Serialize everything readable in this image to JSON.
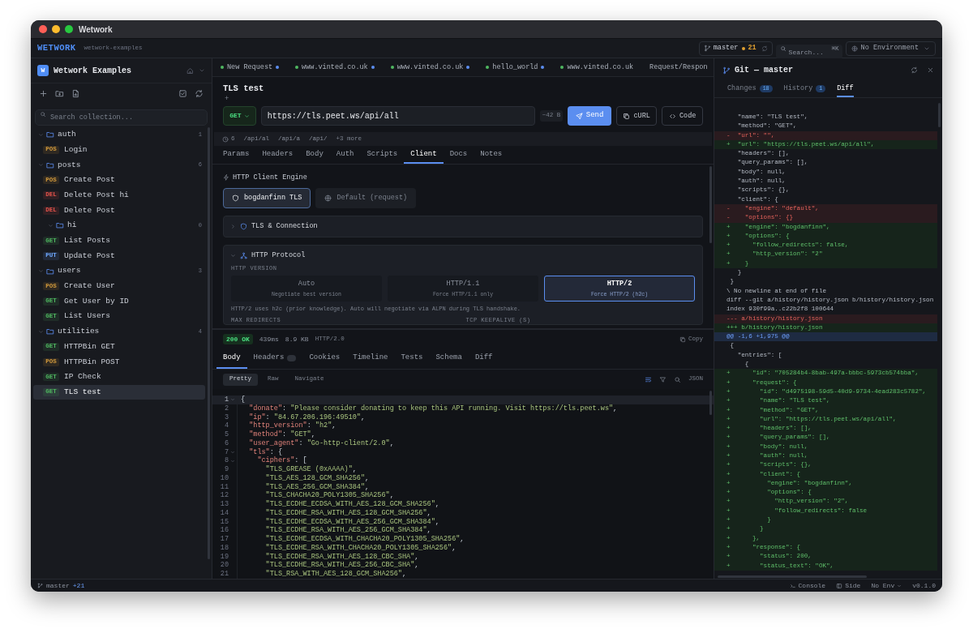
{
  "window": {
    "title": "Wetwork"
  },
  "header": {
    "logo": "WETWORK",
    "workspace": "wetwork-examples",
    "branch": "master",
    "changes": "21",
    "search_placeholder": "Search...",
    "search_shortcut": "⌘K",
    "environment": "No Environment"
  },
  "sidebar": {
    "logo_letter": "W",
    "collection": "Wetwork Examples",
    "search_placeholder": "Search collection...",
    "tree": [
      {
        "kind": "folder",
        "name": "auth",
        "count": "1",
        "expanded": true,
        "children": [
          {
            "kind": "request",
            "method": "POS",
            "color": "#d29a3c",
            "name": "Login",
            "selected": false
          }
        ]
      },
      {
        "kind": "folder",
        "name": "posts",
        "count": "6",
        "expanded": true,
        "children": [
          {
            "kind": "request",
            "method": "POS",
            "color": "#d29a3c",
            "name": "Create Post",
            "selected": false
          },
          {
            "kind": "request",
            "method": "DEL",
            "color": "#e5534b",
            "name": "Delete Post hi",
            "selected": false
          },
          {
            "kind": "request",
            "method": "DEL",
            "color": "#e5534b",
            "name": "Delete Post",
            "selected": false
          },
          {
            "kind": "folder",
            "name": "hi",
            "count": "0",
            "expanded": true
          },
          {
            "kind": "request",
            "method": "GET",
            "color": "#4fb860",
            "name": "List Posts",
            "selected": false
          },
          {
            "kind": "request",
            "method": "PUT",
            "color": "#6ea8ff",
            "name": "Update Post",
            "selected": false
          }
        ]
      },
      {
        "kind": "folder",
        "name": "users",
        "count": "3",
        "expanded": true,
        "children": [
          {
            "kind": "request",
            "method": "POS",
            "color": "#d29a3c",
            "name": "Create User",
            "selected": false
          },
          {
            "kind": "request",
            "method": "GET",
            "color": "#4fb860",
            "name": "Get User by ID",
            "selected": false
          },
          {
            "kind": "request",
            "method": "GET",
            "color": "#4fb860",
            "name": "List Users",
            "selected": false
          }
        ]
      },
      {
        "kind": "folder",
        "name": "utilities",
        "count": "4",
        "expanded": true,
        "children": [
          {
            "kind": "request",
            "method": "GET",
            "color": "#4fb860",
            "name": "HTTPBin GET",
            "selected": false
          },
          {
            "kind": "request",
            "method": "POS",
            "color": "#d29a3c",
            "name": "HTTPBin POST",
            "selected": false
          },
          {
            "kind": "request",
            "method": "GET",
            "color": "#4fb860",
            "name": "IP Check",
            "selected": false
          },
          {
            "kind": "request",
            "method": "GET",
            "color": "#4fb860",
            "name": "TLS test",
            "selected": true
          }
        ]
      }
    ]
  },
  "tabs": [
    {
      "label": "New Request",
      "method_dot": true,
      "unsaved": true
    },
    {
      "label": "www.vinted.co.uk",
      "method_dot": true,
      "unsaved": true
    },
    {
      "label": "www.vinted.co.uk",
      "method_dot": true,
      "unsaved": true
    },
    {
      "label": "hello_world",
      "method_dot": true,
      "unsaved": true
    },
    {
      "label": "www.vinted.co.uk",
      "method_dot": true,
      "unsaved": false
    },
    {
      "label": "Request/Respon",
      "method_dot": false,
      "unsaved": false
    }
  ],
  "request": {
    "title": "TLS test",
    "add_description": "+",
    "method": "GET",
    "url": "https://tls.peet.ws/api/all",
    "size": "~42 B",
    "buttons": [
      {
        "label": "Send",
        "kind": "primary"
      },
      {
        "label": "cURL",
        "kind": "curl"
      },
      {
        "label": "Code",
        "kind": "code"
      }
    ],
    "history_count": "6",
    "history": [
      "/api/al",
      "/api/a",
      "/api/"
    ],
    "history_more": "+3 more",
    "tabs": [
      {
        "label": "Params",
        "selected": false
      },
      {
        "label": "Headers",
        "selected": false
      },
      {
        "label": "Body",
        "selected": false
      },
      {
        "label": "Auth",
        "selected": false
      },
      {
        "label": "Scripts",
        "selected": false
      },
      {
        "label": "Client",
        "selected": true
      },
      {
        "label": "Docs",
        "selected": false
      },
      {
        "label": "Notes",
        "selected": false
      }
    ],
    "client": {
      "title": "HTTP Client Engine",
      "engines": [
        {
          "label": "bogdanfinn TLS",
          "kind": "tls",
          "selected": true
        },
        {
          "label": "Default (request)",
          "kind": "default",
          "selected": false
        }
      ],
      "sections": [
        {
          "title": "TLS & Connection",
          "kind": "tls",
          "expanded": false
        },
        {
          "title": "HTTP Protocol",
          "kind": "protocol",
          "expanded": true,
          "version_label": "HTTP VERSION",
          "versions": [
            {
              "label": "Auto",
              "hint": "Negotiate best version",
              "selected": false
            },
            {
              "label": "HTTP/1.1",
              "hint": "Force HTTP/1.1 only",
              "selected": false
            },
            {
              "label": "HTTP/2",
              "hint": "Force HTTP/2 (h2c)",
              "selected": true
            }
          ],
          "note": "HTTP/2 uses h2c (prior knowledge). Auto will negotiate via ALPN during TLS handshake.",
          "fields": [
            "MAX REDIRECTS",
            "TCP KEEPALIVE (S)"
          ]
        }
      ]
    }
  },
  "response": {
    "status": "200 OK",
    "time": "439ms",
    "size": "8.9 KB",
    "protocol": "HTTP/2.0",
    "copy": "Copy",
    "tabs": [
      {
        "label": "Body",
        "selected": true,
        "badge": false
      },
      {
        "label": "Headers",
        "selected": false,
        "badge": true
      },
      {
        "label": "Cookies",
        "selected": false,
        "badge": false
      },
      {
        "label": "Timeline",
        "selected": false,
        "badge": false
      },
      {
        "label": "Tests",
        "selected": false,
        "badge": false
      },
      {
        "label": "Schema",
        "selected": false,
        "badge": false
      },
      {
        "label": "Diff",
        "selected": false,
        "badge": false
      }
    ],
    "views": [
      {
        "label": "Pretty",
        "selected": true
      },
      {
        "label": "Raw",
        "selected": false
      },
      {
        "label": "Navigate",
        "selected": false
      }
    ],
    "format": "JSON",
    "lines": [
      {
        "n": "1",
        "text": "{",
        "fold": true,
        "current": true
      },
      {
        "n": "2",
        "text": "  \"donate\": \"Please consider donating to keep this API running. Visit https://tls.peet.ws\",",
        "fold": false,
        "current": false
      },
      {
        "n": "3",
        "text": "  \"ip\": \"84.67.206.196:49510\",",
        "fold": false,
        "current": false
      },
      {
        "n": "4",
        "text": "  \"http_version\": \"h2\",",
        "fold": false,
        "current": false
      },
      {
        "n": "5",
        "text": "  \"method\": \"GET\",",
        "fold": false,
        "current": false
      },
      {
        "n": "6",
        "text": "  \"user_agent\": \"Go-http-client/2.0\",",
        "fold": false,
        "current": false
      },
      {
        "n": "7",
        "text": "  \"tls\": {",
        "fold": true,
        "current": false
      },
      {
        "n": "8",
        "text": "    \"ciphers\": [",
        "fold": true,
        "current": false
      },
      {
        "n": "9",
        "text": "      \"TLS_GREASE (0xAAAA)\",",
        "fold": false,
        "current": false
      },
      {
        "n": "10",
        "text": "      \"TLS_AES_128_GCM_SHA256\",",
        "fold": false,
        "current": false
      },
      {
        "n": "11",
        "text": "      \"TLS_AES_256_GCM_SHA384\",",
        "fold": false,
        "current": false
      },
      {
        "n": "12",
        "text": "      \"TLS_CHACHA20_POLY1305_SHA256\",",
        "fold": false,
        "current": false
      },
      {
        "n": "13",
        "text": "      \"TLS_ECDHE_ECDSA_WITH_AES_128_GCM_SHA256\",",
        "fold": false,
        "current": false
      },
      {
        "n": "14",
        "text": "      \"TLS_ECDHE_RSA_WITH_AES_128_GCM_SHA256\",",
        "fold": false,
        "current": false
      },
      {
        "n": "15",
        "text": "      \"TLS_ECDHE_ECDSA_WITH_AES_256_GCM_SHA384\",",
        "fold": false,
        "current": false
      },
      {
        "n": "16",
        "text": "      \"TLS_ECDHE_RSA_WITH_AES_256_GCM_SHA384\",",
        "fold": false,
        "current": false
      },
      {
        "n": "17",
        "text": "      \"TLS_ECDHE_ECDSA_WITH_CHACHA20_POLY1305_SHA256\",",
        "fold": false,
        "current": false
      },
      {
        "n": "18",
        "text": "      \"TLS_ECDHE_RSA_WITH_CHACHA20_POLY1305_SHA256\",",
        "fold": false,
        "current": false
      },
      {
        "n": "19",
        "text": "      \"TLS_ECDHE_RSA_WITH_AES_128_CBC_SHA\",",
        "fold": false,
        "current": false
      },
      {
        "n": "20",
        "text": "      \"TLS_ECDHE_RSA_WITH_AES_256_CBC_SHA\",",
        "fold": false,
        "current": false
      },
      {
        "n": "21",
        "text": "      \"TLS_RSA_WITH_AES_128_GCM_SHA256\",",
        "fold": false,
        "current": false
      }
    ]
  },
  "git_panel": {
    "title": "Git — master",
    "tabs": [
      {
        "label": "Changes",
        "count": "18",
        "selected": false
      },
      {
        "label": "History",
        "count": "1",
        "selected": false
      },
      {
        "label": "Diff",
        "selected": true
      }
    ],
    "lines": [
      {
        "kind": "ctx",
        "text": "   \"name\": \"TLS test\","
      },
      {
        "kind": "ctx",
        "text": "   \"method\": \"GET\","
      },
      {
        "kind": "del",
        "text": "-  \"url\": \"\","
      },
      {
        "kind": "add",
        "text": "+  \"url\": \"https://tls.peet.ws/api/all\","
      },
      {
        "kind": "ctx",
        "text": "   \"headers\": [],"
      },
      {
        "kind": "ctx",
        "text": "   \"query_params\": [],"
      },
      {
        "kind": "ctx",
        "text": "   \"body\": null,"
      },
      {
        "kind": "ctx",
        "text": "   \"auth\": null,"
      },
      {
        "kind": "ctx",
        "text": "   \"scripts\": {},"
      },
      {
        "kind": "ctx",
        "text": "   \"client\": {"
      },
      {
        "kind": "del",
        "text": "-    \"engine\": \"default\","
      },
      {
        "kind": "del",
        "text": "-    \"options\": {}"
      },
      {
        "kind": "add",
        "text": "+    \"engine\": \"bogdanfinn\","
      },
      {
        "kind": "add",
        "text": "+    \"options\": {"
      },
      {
        "kind": "add",
        "text": "+      \"follow_redirects\": false,"
      },
      {
        "kind": "add",
        "text": "+      \"http_version\": \"2\""
      },
      {
        "kind": "add",
        "text": "+    }"
      },
      {
        "kind": "ctx",
        "text": "   }"
      },
      {
        "kind": "ctx",
        "text": " }"
      },
      {
        "kind": "meta",
        "text": "\\ No newline at end of file"
      },
      {
        "kind": "meta",
        "text": "diff --git a/history/history.json b/history/history.json"
      },
      {
        "kind": "meta",
        "text": "index 930f99a..c22b2f8 100644"
      },
      {
        "kind": "file_del",
        "text": "--- a/history/history.json"
      },
      {
        "kind": "file_add",
        "text": "+++ b/history/history.json"
      },
      {
        "kind": "hunk",
        "text": "@@ -1,6 +1,975 @@"
      },
      {
        "kind": "ctx",
        "text": " {"
      },
      {
        "kind": "ctx",
        "text": "   \"entries\": ["
      },
      {
        "kind": "ctx",
        "text": "     {"
      },
      {
        "kind": "add",
        "text": "+      \"id\": \"705284b4-8bab-497a-bbbc-5973cb574bba\","
      },
      {
        "kind": "add",
        "text": "+      \"request\": {"
      },
      {
        "kind": "add",
        "text": "+        \"id\": \"d4975198-59d5-40d9-9734-4ead283c5782\","
      },
      {
        "kind": "add",
        "text": "+        \"name\": \"TLS test\","
      },
      {
        "kind": "add",
        "text": "+        \"method\": \"GET\","
      },
      {
        "kind": "add",
        "text": "+        \"url\": \"https://tls.peet.ws/api/all\","
      },
      {
        "kind": "add",
        "text": "+        \"headers\": [],"
      },
      {
        "kind": "add",
        "text": "+        \"query_params\": [],"
      },
      {
        "kind": "add",
        "text": "+        \"body\": null,"
      },
      {
        "kind": "add",
        "text": "+        \"auth\": null,"
      },
      {
        "kind": "add",
        "text": "+        \"scripts\": {},"
      },
      {
        "kind": "add",
        "text": "+        \"client\": {"
      },
      {
        "kind": "add",
        "text": "+          \"engine\": \"bogdanfinn\","
      },
      {
        "kind": "add",
        "text": "+          \"options\": {"
      },
      {
        "kind": "add",
        "text": "+            \"http_version\": \"2\","
      },
      {
        "kind": "add",
        "text": "+            \"follow_redirects\": false"
      },
      {
        "kind": "add",
        "text": "+          }"
      },
      {
        "kind": "add",
        "text": "+        }"
      },
      {
        "kind": "add",
        "text": "+      },"
      },
      {
        "kind": "add",
        "text": "+      \"response\": {"
      },
      {
        "kind": "add",
        "text": "+        \"status\": 200,"
      },
      {
        "kind": "add",
        "text": "+        \"status_text\": \"OK\","
      }
    ]
  },
  "status_bar": {
    "branch": "master",
    "ahead": "+21",
    "console": "Console",
    "side": "Side",
    "environment": "No Env",
    "version": "v0.1.0"
  }
}
